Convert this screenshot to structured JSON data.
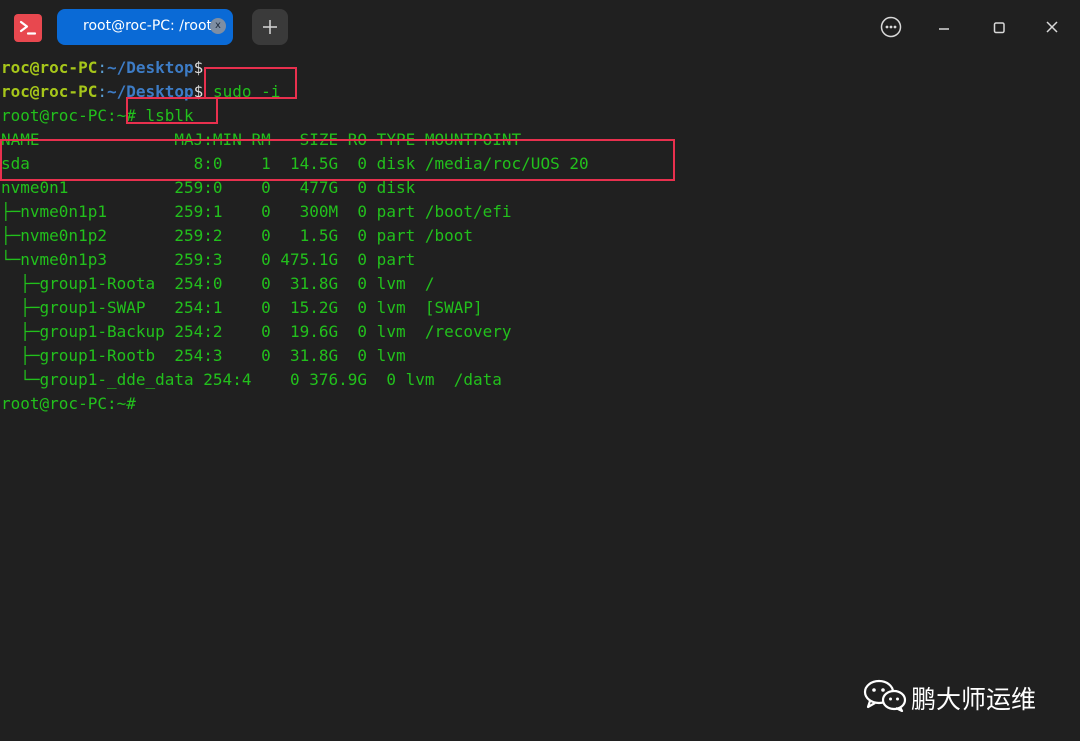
{
  "titlebar": {
    "tab_title": "root@roc-PC: /root",
    "tab_close_glyph": "x",
    "icons": {
      "app": "terminal-app-icon",
      "new_tab": "plus-icon",
      "more": "more-options-icon",
      "minimize": "minimize-icon",
      "maximize": "maximize-icon",
      "close": "close-icon"
    }
  },
  "terminal": {
    "prompt1": {
      "user": "roc@roc-PC",
      "sep": ":",
      "path": "~/Desktop",
      "sym": "$",
      "cmd": ""
    },
    "prompt2": {
      "user": "roc@roc-PC",
      "sep": ":",
      "path": "~/Desktop",
      "sym": "$",
      "cmd": " sudo -i"
    },
    "prompt3": {
      "text": "root@roc-PC:~# lsblk"
    },
    "lsblk_header": "NAME              MAJ:MIN RM   SIZE RO TYPE MOUNTPOINT",
    "lsblk_rows": [
      "sda                 8:0    1  14.5G  0 disk /media/roc/UOS 20",
      "nvme0n1           259:0    0   477G  0 disk ",
      "├─nvme0n1p1       259:1    0   300M  0 part /boot/efi",
      "├─nvme0n1p2       259:2    0   1.5G  0 part /boot",
      "└─nvme0n1p3       259:3    0 475.1G  0 part ",
      "  ├─group1-Roota  254:0    0  31.8G  0 lvm  /",
      "  ├─group1-SWAP   254:1    0  15.2G  0 lvm  [SWAP]",
      "  ├─group1-Backup 254:2    0  19.6G  0 lvm  /recovery",
      "  ├─group1-Rootb  254:3    0  31.8G  0 lvm  ",
      "  └─group1-_dde_data 254:4    0 376.9G  0 lvm  /data"
    ],
    "prompt_final": "root@roc-PC:~#"
  },
  "colors": {
    "background": "#202020",
    "terminal_green": "#22c01c",
    "user_prompt": "#a6c61a",
    "path_blue": "#3d7cc6",
    "highlight_red": "#e8304e",
    "tab_active": "#0a6ad6"
  },
  "watermark": {
    "text": "鹏大师运维",
    "icon": "wechat-icon"
  }
}
